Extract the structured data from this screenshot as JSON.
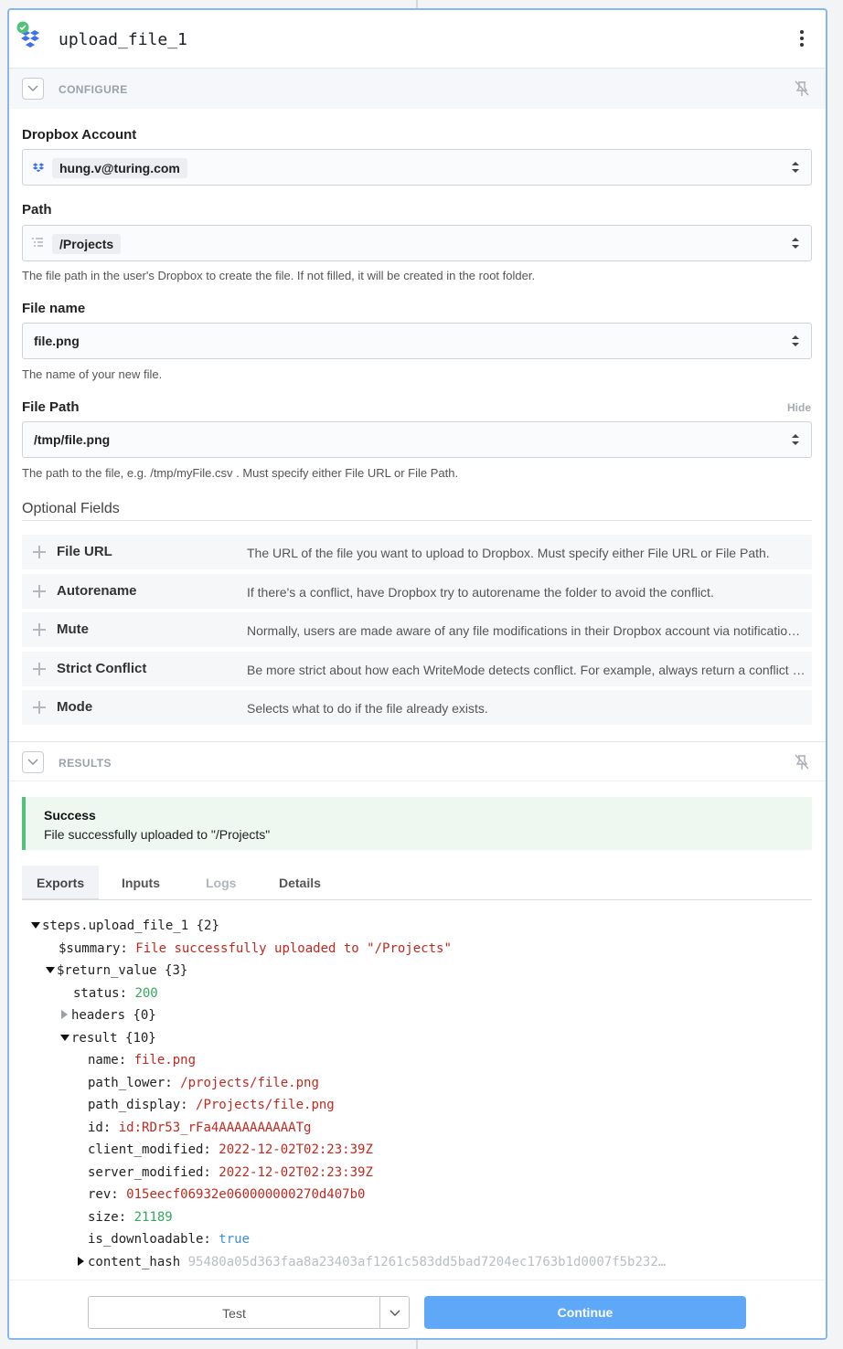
{
  "step": {
    "title": "upload_file_1",
    "app_icon": "dropbox-icon",
    "status_icon": "check-circle-icon"
  },
  "configure": {
    "label": "CONFIGURE"
  },
  "fields": {
    "account": {
      "label": "Dropbox Account",
      "value": "hung.v@turing.com"
    },
    "path": {
      "label": "Path",
      "value": "/Projects",
      "help": "The file path in the user's Dropbox to create the file. If not filled, it will be created in the root folder."
    },
    "file_name": {
      "label": "File name",
      "value": "file.png",
      "help": "The name of your new file."
    },
    "file_path": {
      "label": "File Path",
      "hide": "Hide",
      "value": "/tmp/file.png",
      "help": "The path to the file, e.g. /tmp/myFile.csv . Must specify either File URL or File Path."
    }
  },
  "optional": {
    "title": "Optional Fields",
    "items": [
      {
        "name": "File URL",
        "desc": "The URL of the file you want to upload to Dropbox. Must specify either File URL or File Path."
      },
      {
        "name": "Autorename",
        "desc": "If there's a conflict, have Dropbox try to autorename the folder to avoid the conflict."
      },
      {
        "name": "Mute",
        "desc": "Normally, users are made aware of any file modifications in their Dropbox account via notifications in the client software. If true, this tells the clients that this modification shouldn't result in a user notification."
      },
      {
        "name": "Strict Conflict",
        "desc": "Be more strict about how each WriteMode detects conflict. For example, always return a conflict error when mode = WriteMode.update and the given \"rev\" doesn't match the existing file's \"rev\", even if the existing file has been deleted."
      },
      {
        "name": "Mode",
        "desc": "Selects what to do if the file already exists."
      }
    ]
  },
  "results": {
    "label": "RESULTS",
    "alert_title": "Success",
    "alert_message": "File successfully uploaded to \"/Projects\"",
    "tabs": [
      "Exports",
      "Inputs",
      "Logs",
      "Details"
    ],
    "tree": {
      "root_key": "steps.upload_file_1",
      "root_count": "{2}",
      "summary_key": "$summary:",
      "summary_val": "File successfully uploaded to \"/Projects\"",
      "return_key": "$return_value",
      "return_count": "{3}",
      "status_key": "status:",
      "status_val": "200",
      "headers_key": "headers",
      "headers_count": "{0}",
      "result_key": "result",
      "result_count": "{10}",
      "name_key": "name:",
      "name_val": "file.png",
      "path_lower_key": "path_lower:",
      "path_lower_val": "/projects/file.png",
      "path_display_key": "path_display:",
      "path_display_val": "/Projects/file.png",
      "id_key": "id:",
      "id_val": "id:RDr53_rFa4AAAAAAAAAATg",
      "client_modified_key": "client_modified:",
      "client_modified_val": "2022-12-02T02:23:39Z",
      "server_modified_key": "server_modified:",
      "server_modified_val": "2022-12-02T02:23:39Z",
      "rev_key": "rev:",
      "rev_val": "015eecf06932e060000000270d407b0",
      "size_key": "size:",
      "size_val": "21189",
      "is_downloadable_key": "is_downloadable:",
      "is_downloadable_val": "true",
      "content_hash_key": "content_hash",
      "content_hash_val": "95480a05d363faa8a23403af1261c583dd5bad7204ec1763b1d0007f5b232…"
    }
  },
  "footer": {
    "test_label": "Test",
    "continue_label": "Continue"
  },
  "colors": {
    "accent": "#5ea8f7",
    "success": "#52c27a",
    "string": "#c0291f",
    "number": "#35a85b",
    "boolean": "#3c8de0"
  }
}
